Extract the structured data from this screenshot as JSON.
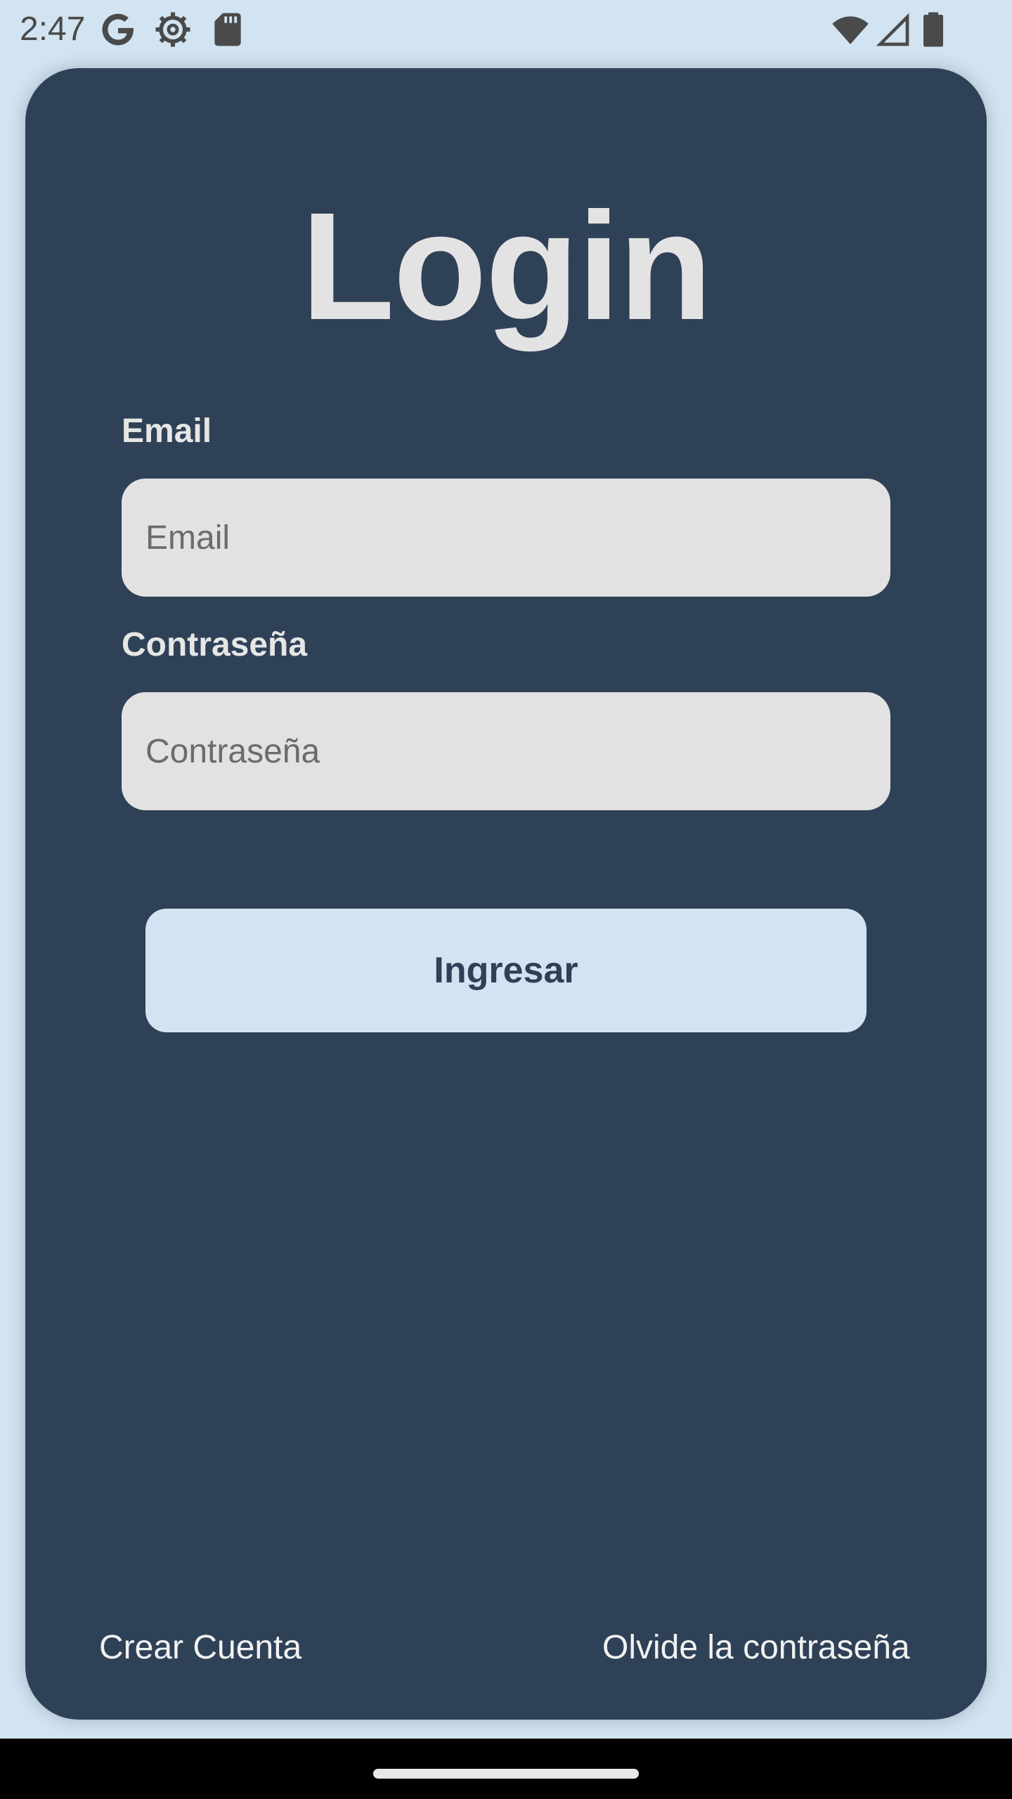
{
  "status_bar": {
    "time": "2:47",
    "left_icons": [
      "google-icon",
      "settings-gear-icon",
      "sd-card-icon"
    ],
    "right_icons": [
      "wifi-icon",
      "cell-signal-icon",
      "battery-icon"
    ]
  },
  "login": {
    "title": "Login",
    "email_label": "Email",
    "email_placeholder": "Email",
    "email_value": "",
    "password_label": "Contraseña",
    "password_placeholder": "Contraseña",
    "password_value": "",
    "submit_label": "Ingresar",
    "create_account_label": "Crear Cuenta",
    "forgot_password_label": "Olvide la contraseña"
  },
  "colors": {
    "background": "#d2e4f1",
    "card": "#2f4156",
    "input": "#e2e2e2",
    "button": "#d2e4f1",
    "button_text": "#2f4156",
    "title": "#e3e3e3"
  }
}
